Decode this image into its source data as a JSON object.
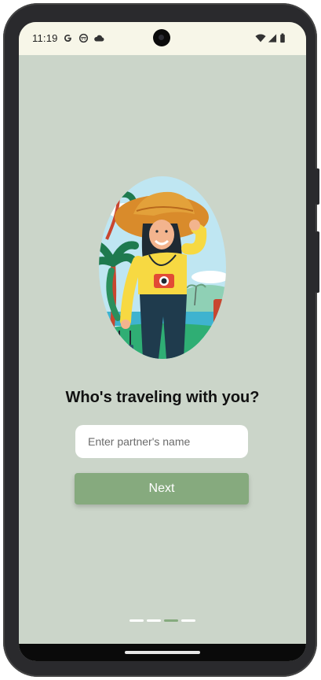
{
  "status_bar": {
    "time": "11:19",
    "left_icons": [
      "google-g-icon",
      "face-icon",
      "cloud-icon"
    ],
    "right_icons": [
      "wifi-icon",
      "signal-icon",
      "battery-icon"
    ]
  },
  "onboarding": {
    "heading": "Who's traveling with you?",
    "partner_input": {
      "placeholder": "Enter partner's name",
      "value": ""
    },
    "next_label": "Next",
    "page_indicator": {
      "total": 4,
      "current": 3
    }
  },
  "colors": {
    "background": "#cbd5c9",
    "accent": "#86aa7e",
    "status_bar": "#f7f6e8"
  }
}
